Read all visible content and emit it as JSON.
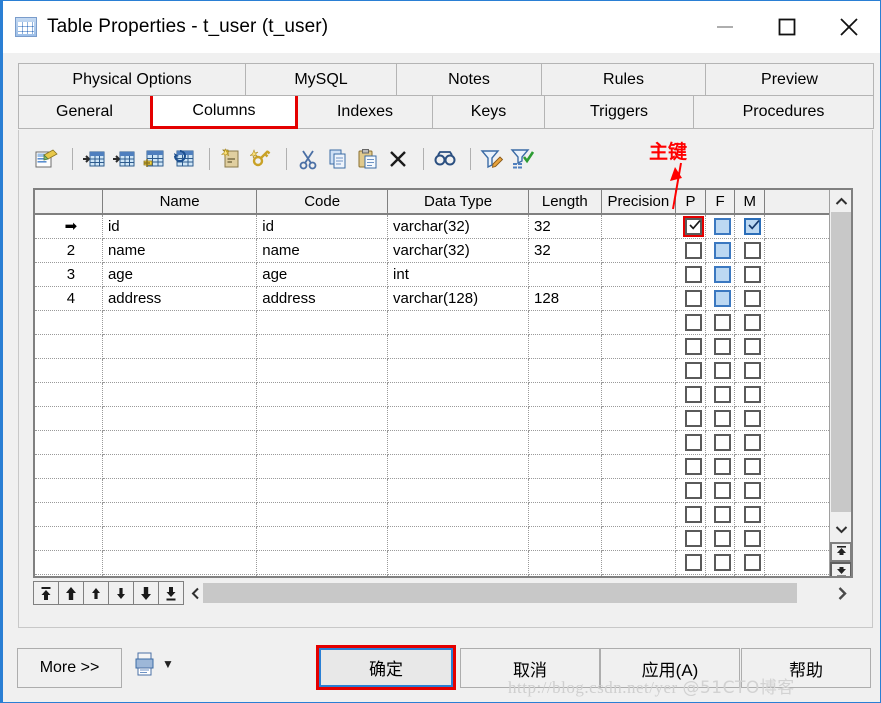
{
  "window": {
    "title": "Table Properties - t_user (t_user)",
    "icon": "table-icon",
    "minimize_label": "Minimize",
    "maximize_label": "Maximize",
    "close_label": "Close"
  },
  "tabs": {
    "row1": [
      {
        "label": "Physical Options",
        "active": false
      },
      {
        "label": "MySQL",
        "active": false
      },
      {
        "label": "Notes",
        "active": false
      },
      {
        "label": "Rules",
        "active": false
      },
      {
        "label": "Preview",
        "active": false
      }
    ],
    "row2": [
      {
        "label": "General",
        "active": false
      },
      {
        "label": "Columns",
        "active": true
      },
      {
        "label": "Indexes",
        "active": false
      },
      {
        "label": "Keys",
        "active": false
      },
      {
        "label": "Triggers",
        "active": false
      },
      {
        "label": "Procedures",
        "active": false
      }
    ]
  },
  "toolbar": {
    "items": [
      {
        "name": "properties-icon",
        "tooltip": "Properties"
      },
      {
        "name": "separator",
        "tooltip": ""
      },
      {
        "name": "insert-row-icon",
        "tooltip": "Insert a Row"
      },
      {
        "name": "add-row-icon",
        "tooltip": "Add a Row"
      },
      {
        "name": "add-column-icon",
        "tooltip": "Add Column"
      },
      {
        "name": "refresh-column-icon",
        "tooltip": "Refresh Column"
      },
      {
        "name": "separator",
        "tooltip": ""
      },
      {
        "name": "note-icon",
        "tooltip": "Notes"
      },
      {
        "name": "key-icon",
        "tooltip": "Primary Key"
      },
      {
        "name": "separator",
        "tooltip": ""
      },
      {
        "name": "cut-icon",
        "tooltip": "Cut"
      },
      {
        "name": "copy-icon",
        "tooltip": "Copy"
      },
      {
        "name": "paste-icon",
        "tooltip": "Paste"
      },
      {
        "name": "delete-icon",
        "tooltip": "Delete"
      },
      {
        "name": "separator",
        "tooltip": ""
      },
      {
        "name": "find-icon",
        "tooltip": "Find"
      },
      {
        "name": "separator",
        "tooltip": ""
      },
      {
        "name": "filter-edit-icon",
        "tooltip": "Customize Columns and Filter"
      },
      {
        "name": "filter-apply-icon",
        "tooltip": "Apply Filter"
      }
    ]
  },
  "annotation": {
    "text": "主键",
    "color": "#ff0000",
    "points_to": "P"
  },
  "grid": {
    "headers": [
      "",
      "Name",
      "Code",
      "Data Type",
      "Length",
      "Precision",
      "P",
      "F",
      "M",
      ""
    ],
    "rows": [
      {
        "marker": "➡",
        "number": "",
        "name": "id",
        "code": "id",
        "data_type": "varchar(32)",
        "length": "32",
        "precision": "",
        "p": true,
        "f": false,
        "m": true,
        "selected": true
      },
      {
        "marker": "",
        "number": "2",
        "name": "name",
        "code": "name",
        "data_type": "varchar(32)",
        "length": "32",
        "precision": "",
        "p": false,
        "f": false,
        "m": false,
        "selected": false
      },
      {
        "marker": "",
        "number": "3",
        "name": "age",
        "code": "age",
        "data_type": "int",
        "length": "",
        "precision": "",
        "p": false,
        "f": false,
        "m": false,
        "selected": false
      },
      {
        "marker": "",
        "number": "4",
        "name": "address",
        "code": "address",
        "data_type": "varchar(128)",
        "length": "128",
        "precision": "",
        "p": false,
        "f": false,
        "m": false,
        "selected": false
      }
    ],
    "empty_row_count": 13
  },
  "row_nav": {
    "buttons": [
      {
        "name": "move-to-top-button",
        "glyph": "top"
      },
      {
        "name": "move-up-multi-button",
        "glyph": "up-bar"
      },
      {
        "name": "move-up-button",
        "glyph": "up"
      },
      {
        "name": "move-down-button",
        "glyph": "down"
      },
      {
        "name": "move-down-multi-button",
        "glyph": "down-bar"
      },
      {
        "name": "move-to-bottom-button",
        "glyph": "bottom"
      }
    ]
  },
  "footer": {
    "more_label": "More >>",
    "print_icon": "print-icon",
    "print_dropdown": "▼",
    "ok_label": "确定",
    "cancel_label": "取消",
    "apply_label": "应用(A)",
    "help_label": "帮助"
  },
  "watermark": {
    "url": "http://blog.csdn.net/yer",
    "tag": "@51CTO博客"
  },
  "colors": {
    "accent": "#2a7fd4",
    "highlight": "#e40000",
    "checkbox_disabled": "#bcd8f2",
    "dialog_bg": "#f0f0f0"
  }
}
